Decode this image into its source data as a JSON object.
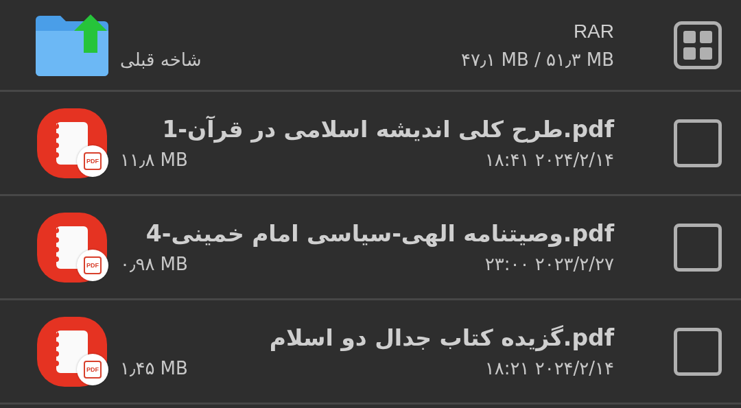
{
  "header": {
    "title": "RAR",
    "parent_label": "شاخه قبلی",
    "usage": "۴۷٫۱ MB / ۵۱٫۳ MB"
  },
  "files": [
    {
      "name": "طرح کلی اندیشه اسلامی در قرآن-1.pdf",
      "badge": "PDF",
      "size": "۱۱٫۸ MB",
      "modified": "۱۸:۴۱ ۲۰۲۴/۲/۱۴",
      "checked": false
    },
    {
      "name": "وصیتنامه الهی-سیاسی امام خمینی-4.pdf",
      "badge": "PDF",
      "size": "۰٫۹۸ MB",
      "modified": "۲۳:۰۰ ۲۰۲۳/۲/۲۷",
      "checked": false
    },
    {
      "name": "گزیده کتاب جدال دو اسلام.pdf",
      "badge": "PDF",
      "size": "۱٫۴۵ MB",
      "modified": "۱۸:۲۱ ۲۰۲۴/۲/۱۴",
      "checked": false
    }
  ]
}
